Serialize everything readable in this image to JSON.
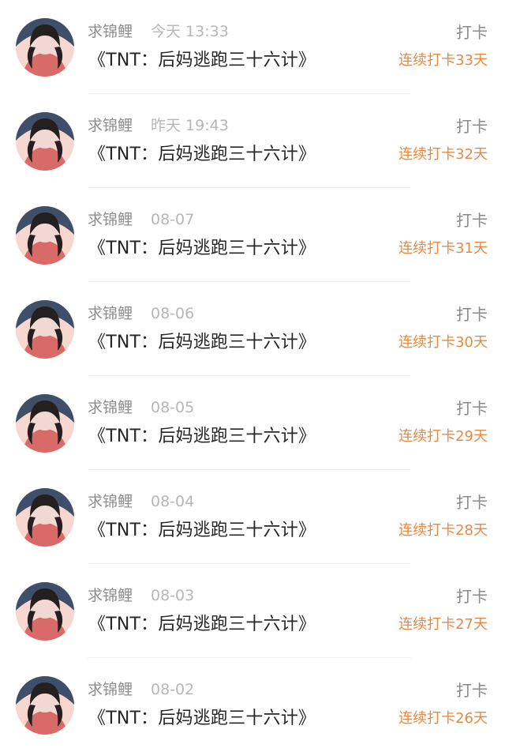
{
  "colors": {
    "name_text": "#8d8d8d",
    "time_text": "#b7b7b7",
    "title_text": "#262626",
    "action_text": "#8a8a8a",
    "streak_text": "#e58a44",
    "divider": "#f0f0f0"
  },
  "entries": [
    {
      "user": "求锦鲤",
      "time": "今天 13:33",
      "title": "《TNT：后妈逃跑三十六计》",
      "action": "打卡",
      "streak": "连续打卡33天",
      "avatar_icon": "avatar-icon"
    },
    {
      "user": "求锦鲤",
      "time": "昨天 19:43",
      "title": "《TNT：后妈逃跑三十六计》",
      "action": "打卡",
      "streak": "连续打卡32天",
      "avatar_icon": "avatar-icon"
    },
    {
      "user": "求锦鲤",
      "time": "08-07",
      "title": "《TNT：后妈逃跑三十六计》",
      "action": "打卡",
      "streak": "连续打卡31天",
      "avatar_icon": "avatar-icon"
    },
    {
      "user": "求锦鲤",
      "time": "08-06",
      "title": "《TNT：后妈逃跑三十六计》",
      "action": "打卡",
      "streak": "连续打卡30天",
      "avatar_icon": "avatar-icon"
    },
    {
      "user": "求锦鲤",
      "time": "08-05",
      "title": "《TNT：后妈逃跑三十六计》",
      "action": "打卡",
      "streak": "连续打卡29天",
      "avatar_icon": "avatar-icon"
    },
    {
      "user": "求锦鲤",
      "time": "08-04",
      "title": "《TNT：后妈逃跑三十六计》",
      "action": "打卡",
      "streak": "连续打卡28天",
      "avatar_icon": "avatar-icon"
    },
    {
      "user": "求锦鲤",
      "time": "08-03",
      "title": "《TNT：后妈逃跑三十六计》",
      "action": "打卡",
      "streak": "连续打卡27天",
      "avatar_icon": "avatar-icon"
    },
    {
      "user": "求锦鲤",
      "time": "08-02",
      "title": "《TNT：后妈逃跑三十六计》",
      "action": "打卡",
      "streak": "连续打卡26天",
      "avatar_icon": "avatar-icon"
    }
  ]
}
